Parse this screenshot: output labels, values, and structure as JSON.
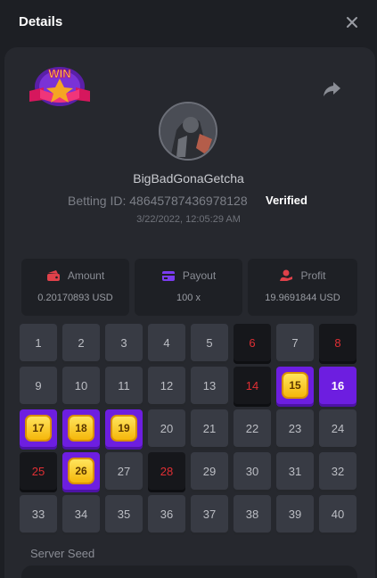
{
  "header": {
    "title": "Details",
    "close_icon": "close-icon"
  },
  "win_badge": {
    "text": "WIN"
  },
  "share_icon": "share-icon",
  "user": {
    "username": "BigBadGonaGetcha",
    "betting_id": "Betting ID: 48645787436978128",
    "verified": "Verified",
    "timestamp": "3/22/2022, 12:05:29 AM"
  },
  "stats": {
    "amount": {
      "label": "Amount",
      "value": "0.20170893 USD",
      "icon": "wallet-icon"
    },
    "payout": {
      "label": "Payout",
      "value": "100 x",
      "icon": "card-icon"
    },
    "profit": {
      "label": "Profit",
      "value": "19.9691844 USD",
      "icon": "coins-icon"
    }
  },
  "grid": {
    "cells": [
      {
        "n": "1",
        "state": "normal"
      },
      {
        "n": "2",
        "state": "normal"
      },
      {
        "n": "3",
        "state": "normal"
      },
      {
        "n": "4",
        "state": "normal"
      },
      {
        "n": "5",
        "state": "normal"
      },
      {
        "n": "6",
        "state": "miss"
      },
      {
        "n": "7",
        "state": "normal"
      },
      {
        "n": "8",
        "state": "miss"
      },
      {
        "n": "9",
        "state": "normal"
      },
      {
        "n": "10",
        "state": "normal"
      },
      {
        "n": "11",
        "state": "normal"
      },
      {
        "n": "12",
        "state": "normal"
      },
      {
        "n": "13",
        "state": "normal"
      },
      {
        "n": "14",
        "state": "miss"
      },
      {
        "n": "15",
        "state": "gem"
      },
      {
        "n": "16",
        "state": "hit"
      },
      {
        "n": "17",
        "state": "gem"
      },
      {
        "n": "18",
        "state": "gem"
      },
      {
        "n": "19",
        "state": "gem"
      },
      {
        "n": "20",
        "state": "normal"
      },
      {
        "n": "21",
        "state": "normal"
      },
      {
        "n": "22",
        "state": "normal"
      },
      {
        "n": "23",
        "state": "normal"
      },
      {
        "n": "24",
        "state": "normal"
      },
      {
        "n": "25",
        "state": "miss"
      },
      {
        "n": "26",
        "state": "gem"
      },
      {
        "n": "27",
        "state": "normal"
      },
      {
        "n": "28",
        "state": "miss"
      },
      {
        "n": "29",
        "state": "normal"
      },
      {
        "n": "30",
        "state": "normal"
      },
      {
        "n": "31",
        "state": "normal"
      },
      {
        "n": "32",
        "state": "normal"
      },
      {
        "n": "33",
        "state": "normal"
      },
      {
        "n": "34",
        "state": "normal"
      },
      {
        "n": "35",
        "state": "normal"
      },
      {
        "n": "36",
        "state": "normal"
      },
      {
        "n": "37",
        "state": "normal"
      },
      {
        "n": "38",
        "state": "normal"
      },
      {
        "n": "39",
        "state": "normal"
      },
      {
        "n": "40",
        "state": "normal"
      }
    ]
  },
  "seed": {
    "label": "Server Seed"
  },
  "colors": {
    "accent": "#6d1ee0",
    "miss": "#e02f34",
    "gem": "#f5c20f",
    "icon_red": "#e0414a",
    "icon_purple": "#7b3cf0"
  }
}
